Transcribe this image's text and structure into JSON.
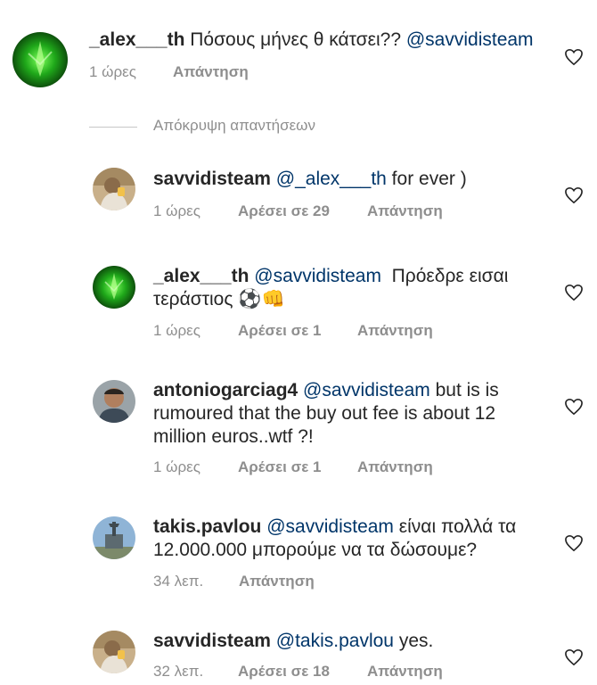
{
  "comments": [
    {
      "username": "_alex___th",
      "text": " Πόσους μήνες θ κάτσει?? ",
      "mention": "@savvidisteam",
      "time": "1 ώρες",
      "likes": "",
      "reply": "Απάντηση",
      "avatar": "green-plant-avatar"
    },
    {
      "username": "savvidisteam",
      "mention": "@_alex___th",
      "text": " for ever )",
      "time": "1 ώρες",
      "likes": "Αρέσει σε 29",
      "reply": "Απάντηση",
      "avatar": "man-with-cup-avatar"
    },
    {
      "username": "_alex___th",
      "mention": "@savvidisteam",
      "text_line1": "  Πρόεδρε εισαι",
      "text_line2": "τεράστιος ⚽👊",
      "time": "1 ώρες",
      "likes": "Αρέσει σε 1",
      "reply": "Απάντηση",
      "avatar": "green-plant-avatar"
    },
    {
      "username": "antoniogarciag4",
      "mention": "@savvidisteam",
      "text_line1": " but is is",
      "text_line2": "rumoured that the buy out fee is about 12",
      "text_line3": "million euros..wtf ?!",
      "time": "1 ώρες",
      "likes": "Αρέσει σε 1",
      "reply": "Απάντηση",
      "avatar": "man-portrait-avatar"
    },
    {
      "username": "takis.pavlou",
      "mention": "@savvidisteam",
      "text_line1": " είναι πολλά τα",
      "text_line2": "12.000.000 μπορούμε να τα δώσουμε?",
      "time": "34 λεπ.",
      "likes": "",
      "reply": "Απάντηση",
      "avatar": "statue-avatar"
    },
    {
      "username": "savvidisteam",
      "mention": "@takis.pavlou",
      "text": " yes.",
      "time": "32 λεπ.",
      "likes": "Αρέσει σε 18",
      "reply": "Απάντηση",
      "avatar": "man-with-cup-avatar"
    }
  ],
  "hide_replies": "Απόκρυψη απαντήσεων",
  "colors": {
    "mention": "#003569",
    "meta": "#8e8e8e",
    "text": "#262626"
  }
}
